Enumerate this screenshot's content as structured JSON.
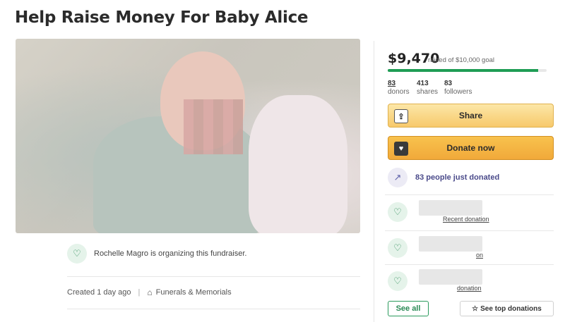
{
  "page": {
    "title": "Help Raise Money For Baby Alice"
  },
  "sidebar": {
    "amount_raised": "$9,470",
    "goal_text": "raised of $10,000 goal",
    "progress_fraction": 0.947,
    "stats": [
      {
        "value": "83",
        "label": "donors"
      },
      {
        "value": "413",
        "label": "shares"
      },
      {
        "value": "83",
        "label": "followers"
      }
    ],
    "share_label": "Share",
    "donate_label": "Donate now",
    "just_donated": "83 people just donated",
    "donations": [
      {
        "label": "Recent donation"
      },
      {
        "label": "on"
      },
      {
        "label": "donation"
      }
    ],
    "see_all_label": "See all",
    "see_top_label": "See top donations"
  },
  "organizer": {
    "text": "Rochelle Magro is organizing this fundraiser."
  },
  "meta": {
    "created": "Created 1 day ago",
    "category": "Funerals & Memorials"
  },
  "colors": {
    "progress": "#1f9d55",
    "donate_button": "#f1a93a",
    "share_button": "#f7c96b",
    "accent_green": "#2a8a55"
  },
  "icons": {
    "share": "share-icon",
    "donate": "donate-icon",
    "trend": "trending-up-icon",
    "donor": "heart-hand-icon",
    "star": "star-icon",
    "tag": "tag-icon"
  }
}
